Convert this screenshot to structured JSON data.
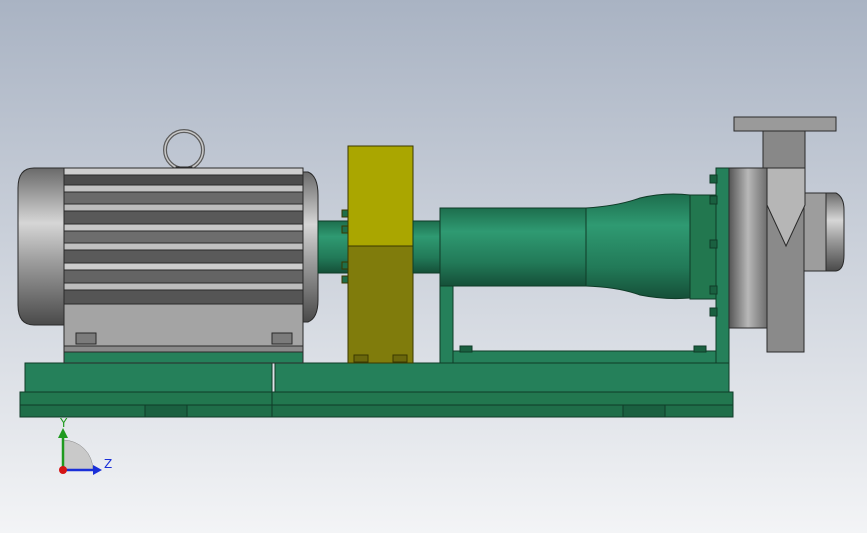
{
  "viewport": {
    "background_top": "#a9b3c3",
    "background_bottom": "#f3f4f6"
  },
  "colors": {
    "baseplate": "#25805a",
    "pump_body": "#2a8a66",
    "motor_gray": "#9a9a9a",
    "coupling_guard": "#a7a40d",
    "axis_x": "#d41515",
    "axis_y": "#1f9a1f",
    "axis_z": "#1a2fd8"
  },
  "triad": {
    "y_label": "Y",
    "z_label": "Z"
  },
  "model": {
    "motor": "electric-motor",
    "coupling": "coupling-guard",
    "pump": "centrifugal-pump",
    "base": "baseplate"
  }
}
